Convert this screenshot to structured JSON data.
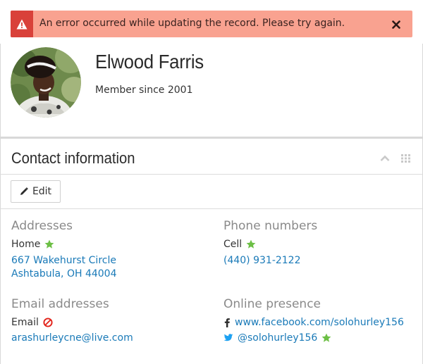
{
  "alert": {
    "message": "An error occurred while updating the record. Please try again.",
    "icon": "warning-icon",
    "close_icon": "close-icon",
    "color": "#f9a290",
    "icon_bg": "#d9413a"
  },
  "profile": {
    "name": "Elwood Farris",
    "member_since": "Member since 2001",
    "avatar_icon": "avatar"
  },
  "contact": {
    "title": "Contact information",
    "edit_label": "Edit",
    "addresses": {
      "heading": "Addresses",
      "label": "Home",
      "line1": "667 Wakehurst Circle",
      "line2": "Ashtabula, OH 44004"
    },
    "phones": {
      "heading": "Phone numbers",
      "label": "Cell",
      "number": "(440) 931-2122"
    },
    "emails": {
      "heading": "Email addresses",
      "label": "Email",
      "address": "arashurleycne@live.com"
    },
    "online": {
      "heading": "Online presence",
      "facebook": "www.facebook.com/solohurley156",
      "twitter": "@solohurley156"
    }
  },
  "colors": {
    "link": "#1a7ab8",
    "star": "#6cbf45",
    "danger": "#e2231a"
  }
}
